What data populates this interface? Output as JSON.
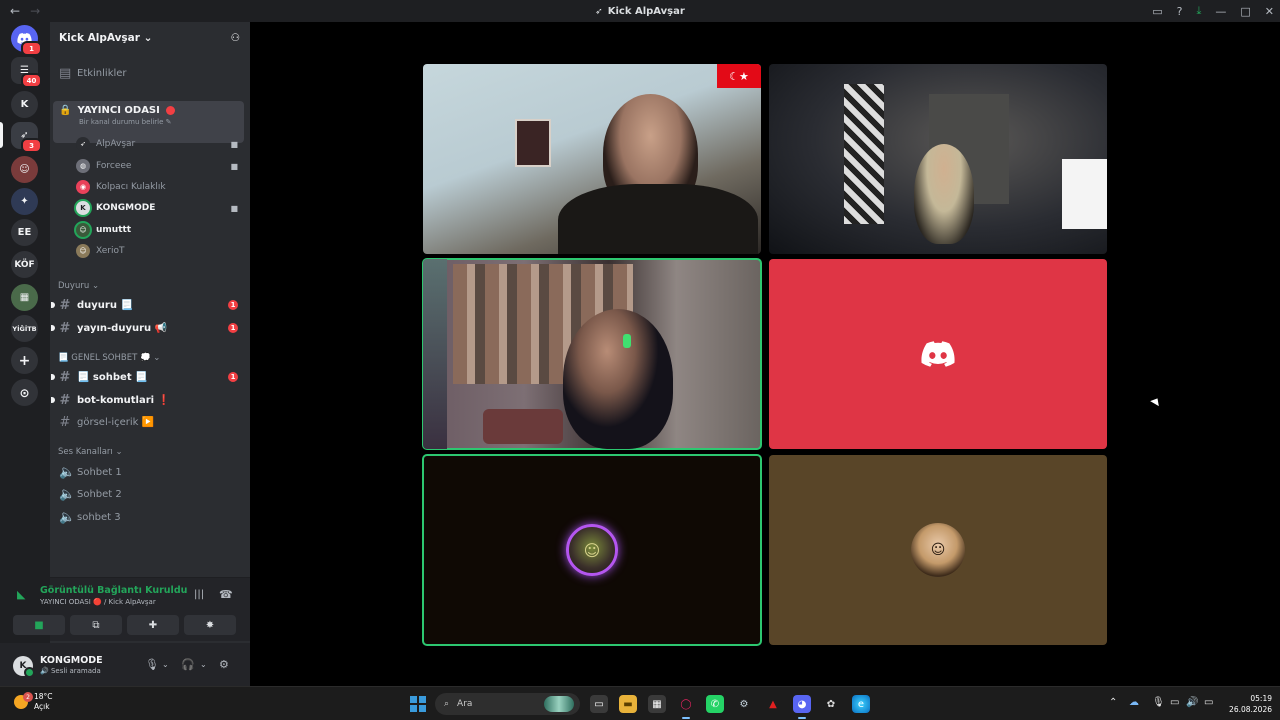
{
  "titlebar": {
    "title": "Kick AlpAvşar",
    "back": "←",
    "forward": "→"
  },
  "rail": {
    "servers": [
      {
        "label": "",
        "icon": "discord-home-icon",
        "badge": "1"
      },
      {
        "label": "",
        "icon": "channels-icon",
        "badge": "40"
      },
      {
        "label": "K",
        "icon": "",
        "badge": ""
      },
      {
        "label": "",
        "icon": "kick-server-icon",
        "badge": "3"
      },
      {
        "label": "",
        "icon": "avatar-server-icon",
        "badge": ""
      },
      {
        "label": "",
        "icon": "esports-server-icon",
        "badge": ""
      },
      {
        "label": "EE",
        "icon": "",
        "badge": ""
      },
      {
        "label": "KÖF",
        "icon": "",
        "badge": ""
      },
      {
        "label": "",
        "icon": "photo-server-icon",
        "badge": ""
      },
      {
        "label": "YİĞİTB",
        "icon": "",
        "badge": ""
      }
    ],
    "add_server": "+",
    "discover": "⊙"
  },
  "sidebar": {
    "server_name": "Kick AlpAvşar",
    "events": "Etkinlikler",
    "voice_channel": {
      "name": "YAYINCI ODASI",
      "status": "Bir kanal durumu belirle"
    },
    "members": [
      {
        "name": "AlpAvşar",
        "speaking": false,
        "camera": true
      },
      {
        "name": "Forceee",
        "speaking": false,
        "camera": true
      },
      {
        "name": "Kolpacı Kulaklık",
        "speaking": false,
        "camera": false
      },
      {
        "name": "KONGMODE",
        "speaking": true,
        "camera": true
      },
      {
        "name": "umuttt",
        "speaking": true,
        "camera": false
      },
      {
        "name": "XerioT",
        "speaking": false,
        "camera": false
      }
    ],
    "categories": {
      "duyuru": "Duyuru",
      "genel": "📃 GENEL SOHBET 💭",
      "ses": "Ses Kanalları"
    },
    "text_channels": [
      {
        "name": "duyuru 📃",
        "unread": true,
        "badge": "1"
      },
      {
        "name": "yayın-duyuru 📢",
        "unread": true,
        "badge": "1"
      },
      {
        "name": "📃 sohbet 📃",
        "unread": true,
        "badge": "1"
      },
      {
        "name": "bot-komutlari ❗",
        "unread": true,
        "badge": ""
      },
      {
        "name": "görsel-içerik ▶️",
        "unread": false,
        "badge": ""
      }
    ],
    "voice_channels": [
      "Sohbet 1",
      "Sohbet 2",
      "sohbet 3"
    ]
  },
  "connection": {
    "status": "Görüntülü Bağlantı Kuruldu",
    "where": "YAYINCI ODASI 🔴 / Kick AlpAvşar"
  },
  "user": {
    "name": "KONGMODE",
    "status": "Sesli aramada",
    "initial": "K"
  },
  "stage": {
    "flag_text": "☾★"
  },
  "taskbar": {
    "temperature": "18°C",
    "weather": "Açık",
    "weather_badge": "2",
    "search_placeholder": "Ara",
    "time": "05:19",
    "date": "26.08.2026"
  },
  "colors": {
    "accent_green": "#23a55a",
    "danger": "#f23f43",
    "discord_tile": "#df3545",
    "avatar_tile": "#594528"
  }
}
